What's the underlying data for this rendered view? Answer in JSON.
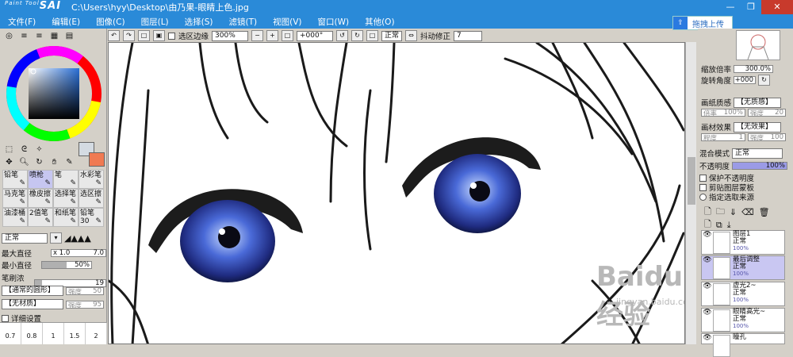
{
  "app": {
    "logo": "SAI",
    "logo_sub": "Paint Tool",
    "title": "C:\\Users\\hyy\\Desktop\\由乃果-眼睛上色.jpg"
  },
  "menu": [
    "文件(F)",
    "编辑(E)",
    "图像(C)",
    "图层(L)",
    "选择(S)",
    "滤镜(T)",
    "视图(V)",
    "窗口(W)",
    "其他(O)"
  ],
  "upload": {
    "label": "拖拽上传"
  },
  "toolbar": {
    "select_edge": "选区边缘",
    "zoom": "300%",
    "angle": "+000°",
    "mode": "正常",
    "stab_label": "抖动修正",
    "stab": "7"
  },
  "left": {
    "brushes": [
      "铅笔",
      "喷枪",
      "笔",
      "水彩笔",
      "马克笔",
      "橡皮擦",
      "选择笔",
      "选区擦",
      "油漆桶",
      "2值笔",
      "和纸笔",
      "铅笔30"
    ],
    "blend": "正常",
    "max_label": "最大直径",
    "max_val": "x 1.0",
    "max_num": "7.0",
    "min_label": "最小直径",
    "min_val": "50%",
    "dens_label": "笔刷浓度",
    "dens_val": "19",
    "shape": "【通常的圆形】",
    "shape_strength": "强度",
    "shape_strength_val": "50",
    "texture": "【无材质】",
    "texture_strength": "强度",
    "texture_strength_val": "95",
    "detail": "详细设置",
    "sizes": [
      "0.7",
      "0.8",
      "1",
      "1.5",
      "2"
    ]
  },
  "right": {
    "nav_zoom_label": "缩放倍率",
    "nav_zoom": "300.0%",
    "nav_rot_label": "旋转角度",
    "nav_rot": "+000",
    "paper_label": "画纸质感",
    "paper": "【无质感】",
    "paper_scale": "倍率",
    "paper_scale_val": "100%",
    "paper_str": "强度",
    "paper_str_val": "20",
    "effect_label": "画材效果",
    "effect": "【无效果】",
    "effect_deg": "程度",
    "effect_deg_val": "1",
    "effect_w": "强度",
    "effect_w_val": "100",
    "blend_label": "混合模式",
    "blend": "正常",
    "opacity_label": "不透明度",
    "opacity": "100%",
    "opt1": "保护不透明度",
    "opt2": "剪贴图层蒙板",
    "opt3": "指定选取来源",
    "layers": [
      {
        "name": "图层1",
        "mode": "正常",
        "pct": "100%"
      },
      {
        "name": "最后调整",
        "mode": "正常",
        "pct": "100%"
      },
      {
        "name": "虚光2~",
        "mode": "正常",
        "pct": "100%"
      },
      {
        "name": "眼睛高光~",
        "mode": "正常",
        "pct": "100%"
      },
      {
        "name": "瞳孔",
        "mode": "",
        "pct": ""
      }
    ]
  },
  "watermark": "Baidu经验",
  "watermark_url": "jingyan.baidu.com"
}
